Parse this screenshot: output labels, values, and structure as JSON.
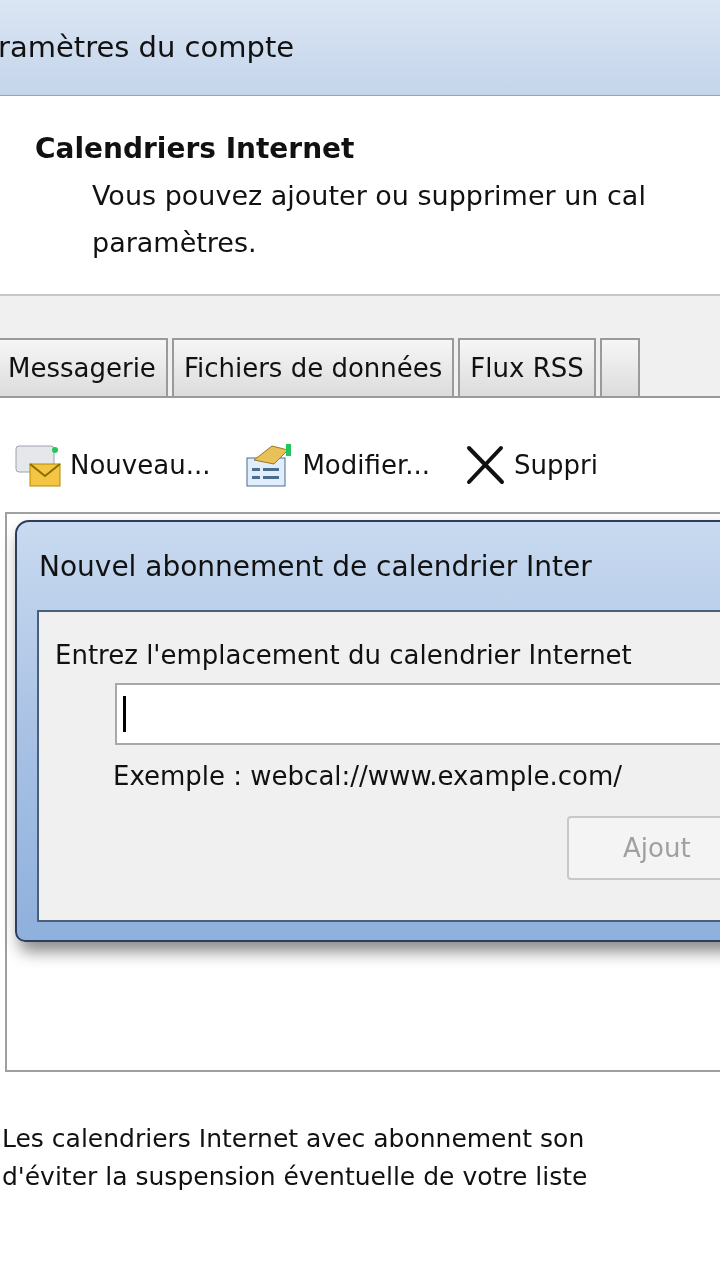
{
  "window": {
    "title": "ramètres du compte"
  },
  "header": {
    "title": "Calendriers Internet",
    "description": [
      "Vous pouvez ajouter ou supprimer un cal",
      "paramètres."
    ]
  },
  "tabs": [
    {
      "label": "Messagerie",
      "selected": false
    },
    {
      "label": "Fichiers de données",
      "selected": false
    },
    {
      "label": "Flux RSS",
      "selected": false
    },
    {
      "selected": false
    }
  ],
  "toolbar": [
    {
      "kind": "new",
      "label": "Nouveau..."
    },
    {
      "kind": "edit",
      "label": "Modifier..."
    },
    {
      "kind": "delete",
      "label": "Suppri"
    }
  ],
  "dialog": {
    "title": "Nouvel abonnement de calendrier Inter",
    "prompt": "Entrez l'emplacement du calendrier Internet",
    "example": "Exemple : webcal://www.example.com/",
    "button": {
      "label": "Ajout",
      "disabled": true
    }
  },
  "footer": [
    "Les calendriers Internet avec abonnement son",
    "d'éviter la suspension éventuelle de votre liste"
  ]
}
